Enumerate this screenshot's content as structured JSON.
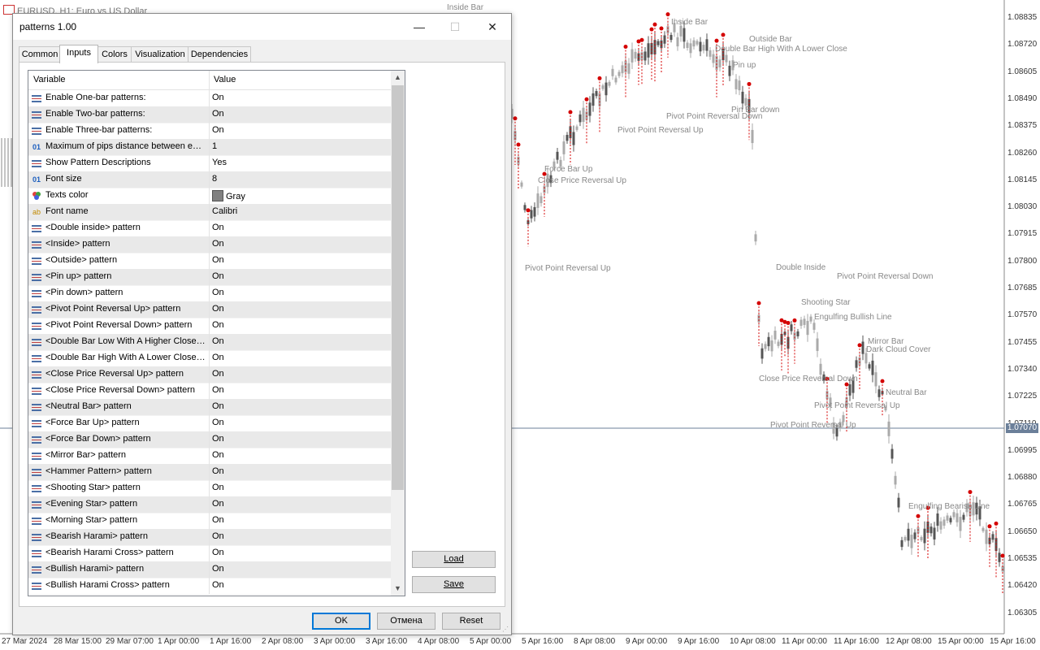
{
  "chart": {
    "title": "EURUSD, H1:  Euro vs US Dollar",
    "current_price": "1.07070",
    "price_ticks": [
      "1.08835",
      "1.08720",
      "1.08605",
      "1.08490",
      "1.08375",
      "1.08260",
      "1.08145",
      "1.08030",
      "1.07915",
      "1.07800",
      "1.07685",
      "1.07570",
      "1.07455",
      "1.07340",
      "1.07225",
      "1.07110",
      "1.06995",
      "1.06880",
      "1.06765",
      "1.06650",
      "1.06535",
      "1.06420",
      "1.06305"
    ],
    "time_ticks": [
      "27 Mar 2024",
      "28 Mar 15:00",
      "29 Mar 07:00",
      "1 Apr 00:00",
      "1 Apr 16:00",
      "2 Apr 08:00",
      "3 Apr 00:00",
      "3 Apr 16:00",
      "4 Apr 08:00",
      "5 Apr 00:00",
      "5 Apr 16:00",
      "8 Apr 08:00",
      "9 Apr 00:00",
      "9 Apr 16:00",
      "10 Apr 08:00",
      "11 Apr 00:00",
      "11 Apr 16:00",
      "12 Apr 08:00",
      "15 Apr 00:00",
      "15 Apr 16:00"
    ],
    "labels": [
      "Inside Bar",
      "Outside Bar",
      "Pin up",
      "Pin Bar down",
      "Pivot Point Reversal Up",
      "Pivot Point Reversal Down",
      "Close Price Reversal Up",
      "Force Bar Up",
      "Neutral Bar",
      "Mirror Bar",
      "Engulfing Bullish Line",
      "Double Inside",
      "Shooting Star",
      "Dark Cloud Cover",
      "Close Price Reversal Down",
      "Double Bar High With A Lower Close",
      "Engulfing Bearish Line"
    ]
  },
  "dialog": {
    "title": "patterns 1.00",
    "controls": {
      "minimize": "—",
      "maximize": "☐",
      "close": "✕"
    },
    "tabs": [
      "Common",
      "Inputs",
      "Colors",
      "Visualization",
      "Dependencies"
    ],
    "active_tab": "Inputs",
    "grid": {
      "col_variable": "Variable",
      "col_value": "Value",
      "rows": [
        {
          "icon": "list",
          "variable": "Enable One-bar patterns:",
          "value": "On"
        },
        {
          "icon": "list",
          "variable": "Enable Two-bar patterns:",
          "value": "On"
        },
        {
          "icon": "list",
          "variable": "Enable Three-bar patterns:",
          "value": "On"
        },
        {
          "icon": "num",
          "variable": "Maximum of pips distance between equal prices",
          "value": "1"
        },
        {
          "icon": "list",
          "variable": "Show Pattern Descriptions",
          "value": "Yes"
        },
        {
          "icon": "num",
          "variable": "Font size",
          "value": "8"
        },
        {
          "icon": "color",
          "variable": "Texts color",
          "value": "Gray"
        },
        {
          "icon": "ab",
          "variable": "Font name",
          "value": "Calibri"
        },
        {
          "icon": "list",
          "variable": "<Double inside> pattern",
          "value": "On"
        },
        {
          "icon": "list",
          "variable": "<Inside> pattern",
          "value": "On"
        },
        {
          "icon": "list",
          "variable": "<Outside> pattern",
          "value": "On"
        },
        {
          "icon": "list",
          "variable": "<Pin up> pattern",
          "value": "On"
        },
        {
          "icon": "list",
          "variable": "<Pin down> pattern",
          "value": "On"
        },
        {
          "icon": "list",
          "variable": "<Pivot Point Reversal Up> pattern",
          "value": "On"
        },
        {
          "icon": "list",
          "variable": "<Pivot Point Reversal Down> pattern",
          "value": "On"
        },
        {
          "icon": "list",
          "variable": "<Double Bar Low With A Higher Close> pattern",
          "value": "On"
        },
        {
          "icon": "list",
          "variable": "<Double Bar High With A Lower Close> pattern",
          "value": "On"
        },
        {
          "icon": "list",
          "variable": "<Close Price Reversal Up> pattern",
          "value": "On"
        },
        {
          "icon": "list",
          "variable": "<Close Price Reversal Down> pattern",
          "value": "On"
        },
        {
          "icon": "list",
          "variable": "<Neutral Bar> pattern",
          "value": "On"
        },
        {
          "icon": "list",
          "variable": "<Force Bar Up> pattern",
          "value": "On"
        },
        {
          "icon": "list",
          "variable": "<Force Bar Down> pattern",
          "value": "On"
        },
        {
          "icon": "list",
          "variable": "<Mirror Bar> pattern",
          "value": "On"
        },
        {
          "icon": "list",
          "variable": "<Hammer Pattern> pattern",
          "value": "On"
        },
        {
          "icon": "list",
          "variable": "<Shooting Star> pattern",
          "value": "On"
        },
        {
          "icon": "list",
          "variable": "<Evening Star> pattern",
          "value": "On"
        },
        {
          "icon": "list",
          "variable": "<Morning Star> pattern",
          "value": "On"
        },
        {
          "icon": "list",
          "variable": "<Bearish Harami> pattern",
          "value": "On"
        },
        {
          "icon": "list",
          "variable": "<Bearish Harami Cross> pattern",
          "value": "On"
        },
        {
          "icon": "list",
          "variable": "<Bullish Harami> pattern",
          "value": "On"
        },
        {
          "icon": "list",
          "variable": "<Bullish Harami Cross> pattern",
          "value": "On"
        }
      ]
    },
    "side_buttons": {
      "load": "Load",
      "save": "Save"
    },
    "buttons": {
      "ok": "OK",
      "cancel": "Отмена",
      "reset": "Reset"
    },
    "colors": {
      "swatch": "#808080",
      "accent": "#0078d7",
      "marker": "#d40000"
    }
  }
}
